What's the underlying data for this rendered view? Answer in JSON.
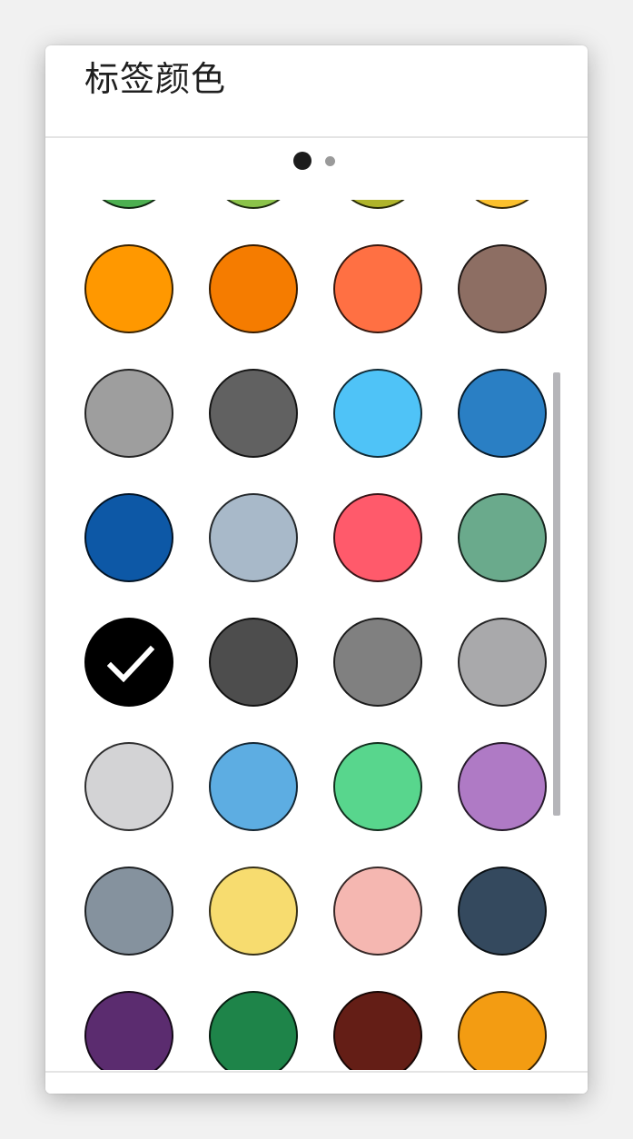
{
  "dialog": {
    "title": "标签颜色"
  },
  "pager": {
    "page_count": 2,
    "active_page": 1
  },
  "color_grid": {
    "columns": 4,
    "selected_color": "#000000",
    "colors": [
      "#4caf50",
      "#8bc34a",
      "#afb42b",
      "#fbc02d",
      "#ff9800",
      "#f57c00",
      "#ff7043",
      "#8d6e63",
      "#9e9e9e",
      "#616161",
      "#4fc3f7",
      "#2a7fc4",
      "#0d58a6",
      "#a8b9c9",
      "#ff5a6b",
      "#6aaa8c",
      "#000000",
      "#4d4d4d",
      "#808080",
      "#a9a9ab",
      "#d3d3d5",
      "#5dade2",
      "#58d68d",
      "#af7ac5",
      "#85929e",
      "#f7dc6f",
      "#f5b7b1",
      "#34495e",
      "#5b2c6f",
      "#1e8449",
      "#641e16",
      "#f39c12"
    ]
  },
  "icons": {
    "selected_marker": "checkmark-icon"
  }
}
